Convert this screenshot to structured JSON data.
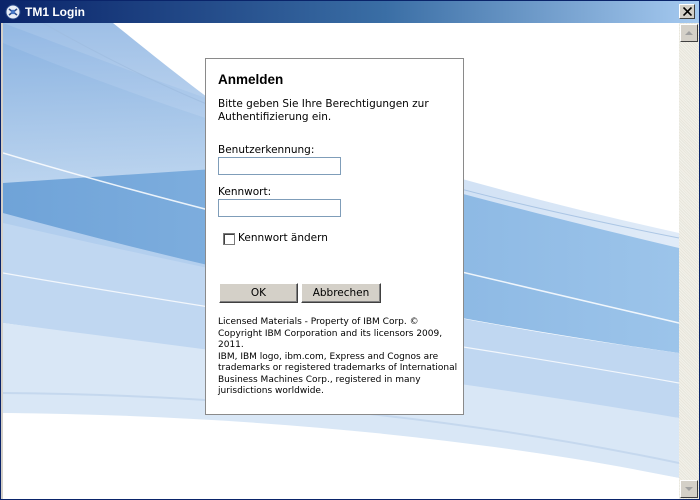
{
  "window": {
    "title": "TM1 Login",
    "icon": "tm1-app-icon",
    "close_icon": "close-icon"
  },
  "dialog": {
    "heading": "Anmelden",
    "intro": "Bitte geben Sie Ihre Berechtigungen zur Authentifizierung ein.",
    "username_label": "Benutzerkennung:",
    "username_value": "",
    "password_label": "Kennwort:",
    "password_value": "",
    "change_password_label": "Kennwort ändern",
    "change_password_checked": false,
    "ok_label": "OK",
    "cancel_label": "Abbrechen",
    "legal_line1": "Licensed Materials - Property of IBM Corp. © Copyright IBM Corporation and its licensors 2009, 2011.",
    "legal_line2": "IBM, IBM logo, ibm.com, Express and Cognos are trademarks or registered trademarks of International Business Machines Corp., registered in many jurisdictions worldwide."
  },
  "colors": {
    "titlebar_start": "#0a246a",
    "titlebar_end": "#a6caf0",
    "background_swoosh": "#7aa9dc"
  }
}
